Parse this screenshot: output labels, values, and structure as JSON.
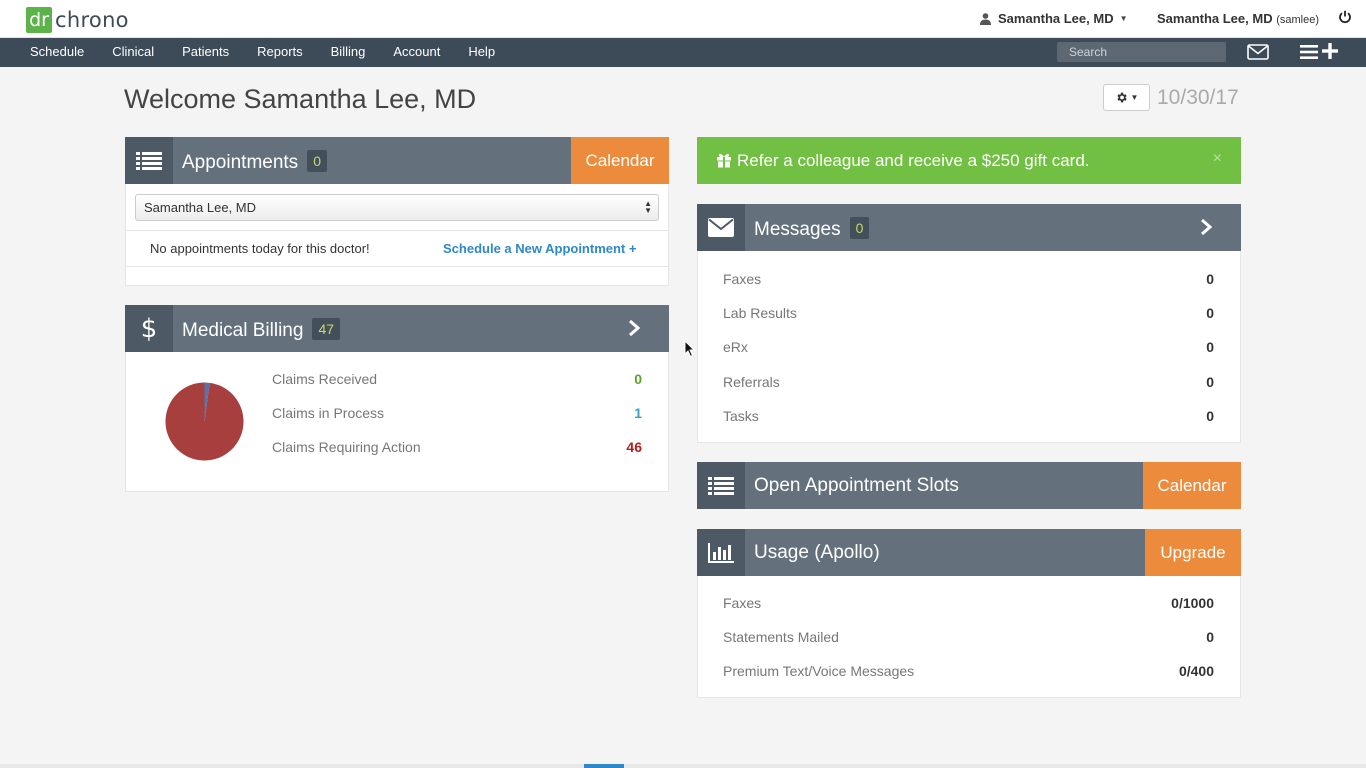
{
  "brand": {
    "logo_mark": "dr",
    "logo_text": "chrono",
    "accent": "#5cb34a"
  },
  "user_menu": {
    "label": "Samantha Lee, MD",
    "icon": "user-icon"
  },
  "account": {
    "name": "Samantha Lee, MD",
    "handle": "(samlee)",
    "power_icon": "power-icon"
  },
  "nav": {
    "items": [
      "Schedule",
      "Clinical",
      "Patients",
      "Reports",
      "Billing",
      "Account",
      "Help"
    ],
    "search_placeholder": "Search"
  },
  "header": {
    "welcome": "Welcome Samantha Lee, MD",
    "date": "10/30/17"
  },
  "appointments": {
    "title": "Appointments",
    "count": "0",
    "calendar_button": "Calendar",
    "doctor_select": "Samantha Lee, MD",
    "empty_text": "No appointments today for this doctor!",
    "schedule_link": "Schedule a New Appointment +"
  },
  "billing": {
    "title": "Medical Billing",
    "count": "47",
    "rows": [
      {
        "label": "Claims Received",
        "value": "0",
        "color": "#5aa32b"
      },
      {
        "label": "Claims in Process",
        "value": "1",
        "color": "#3aa0c8"
      },
      {
        "label": "Claims Requiring Action",
        "value": "46",
        "color": "#b0201e"
      }
    ],
    "pie": {
      "received": 0,
      "in_process": 1,
      "requiring_action": 46,
      "colors": {
        "in_process": "#5b73a8",
        "requiring_action": "#a63f3d"
      }
    }
  },
  "referral": {
    "text": "Refer a colleague and receive a $250 gift card.",
    "close": "×",
    "color": "#72c043"
  },
  "messages": {
    "title": "Messages",
    "count": "0",
    "rows": [
      {
        "label": "Faxes",
        "value": "0"
      },
      {
        "label": "Lab Results",
        "value": "0"
      },
      {
        "label": "eRx",
        "value": "0"
      },
      {
        "label": "Referrals",
        "value": "0"
      },
      {
        "label": "Tasks",
        "value": "0"
      }
    ]
  },
  "open_slots": {
    "title": "Open Appointment Slots",
    "calendar_button": "Calendar"
  },
  "usage": {
    "title": "Usage (Apollo)",
    "upgrade_button": "Upgrade",
    "rows": [
      {
        "label": "Faxes",
        "value": "0/1000"
      },
      {
        "label": "Statements Mailed",
        "value": "0"
      },
      {
        "label": "Premium Text/Voice Messages",
        "value": "0/400"
      }
    ]
  }
}
